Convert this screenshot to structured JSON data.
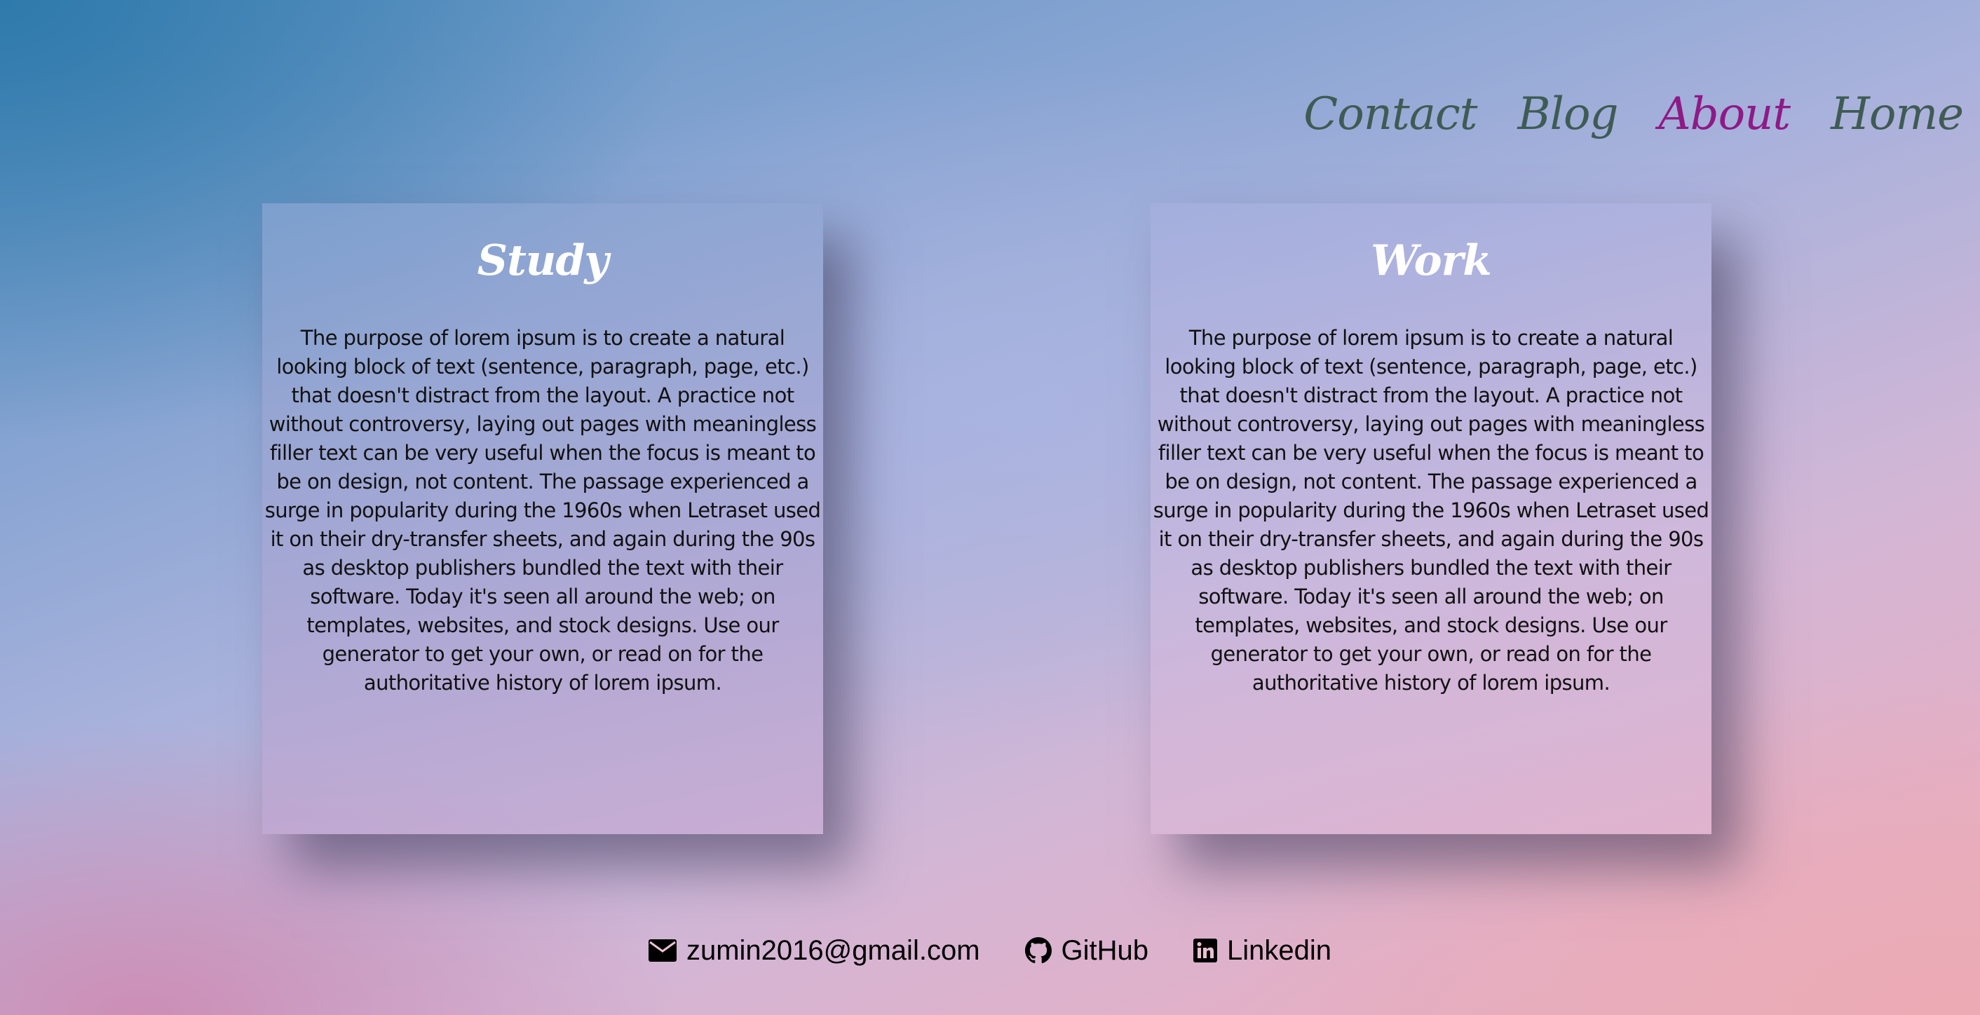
{
  "nav": {
    "items": [
      {
        "label": "Contact",
        "active": false
      },
      {
        "label": "Blog",
        "active": false
      },
      {
        "label": "About",
        "active": true
      },
      {
        "label": "Home",
        "active": false
      }
    ],
    "colors": {
      "default": "#3f5b54",
      "active": "#8e1a86"
    }
  },
  "cards": [
    {
      "title": "Study",
      "body": "The purpose of lorem ipsum is to create a natural looking block of text (sentence, paragraph, page, etc.) that doesn't distract from the layout. A practice not without controversy, laying out pages with meaningless filler text can be very useful when the focus is meant to be on design, not content. The passage experienced a surge in popularity during the 1960s when Letraset used it on their dry-transfer sheets, and again during the 90s as desktop publishers bundled the text with their software. Today it's seen all around the web; on templates, websites, and stock designs. Use our generator to get your own, or read on for the authoritative history of lorem ipsum."
    },
    {
      "title": "Work",
      "body": "The purpose of lorem ipsum is to create a natural looking block of text (sentence, paragraph, page, etc.) that doesn't distract from the layout. A practice not without controversy, laying out pages with meaningless filler text can be very useful when the focus is meant to be on design, not content. The passage experienced a surge in popularity during the 1960s when Letraset used it on their dry-transfer sheets, and again during the 90s as desktop publishers bundled the text with their software. Today it's seen all around the web; on templates, websites, and stock designs. Use our generator to get your own, or read on for the authoritative history of lorem ipsum."
    }
  ],
  "footer": {
    "email": {
      "icon": "envelope-icon",
      "label": "zumin2016@gmail.com"
    },
    "github": {
      "icon": "github-icon",
      "label": "GitHub"
    },
    "linkedin": {
      "icon": "linkedin-icon",
      "label": "Linkedin"
    }
  }
}
